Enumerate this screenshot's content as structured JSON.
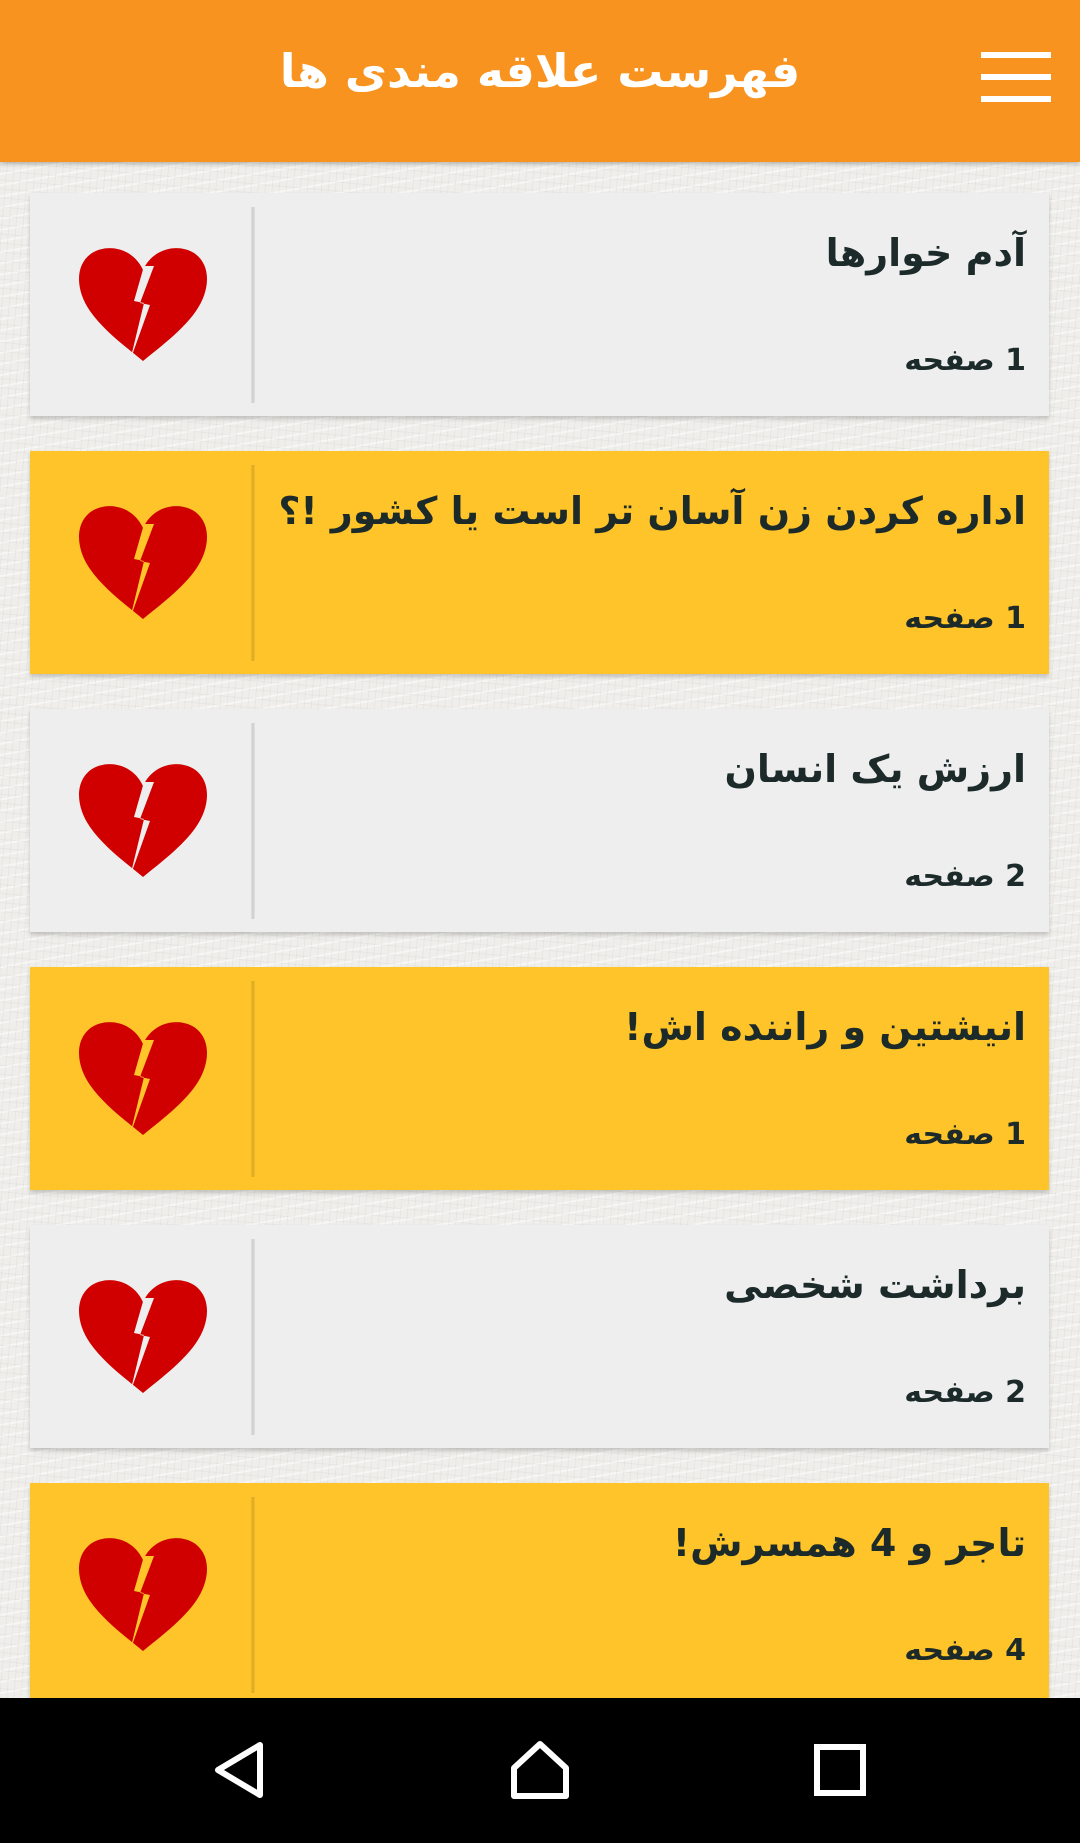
{
  "header": {
    "title": "فهرست علاقه مندی ها",
    "menu_icon": "hamburger-menu-icon",
    "background_color": "#f7931e"
  },
  "favorites": {
    "item_icon": "broken-heart-icon",
    "heart_color": "#d00000",
    "colors": {
      "gray_card": "#eeeeee",
      "yellow_card": "#fec429"
    },
    "items": [
      {
        "title": "آدم خوارها",
        "pages": "1 صفحه",
        "style": "gray"
      },
      {
        "title": "اداره کردن زن آسان تر است یا کشور !؟",
        "pages": "1 صفحه",
        "style": "yellow"
      },
      {
        "title": "ارزش یک انسان",
        "pages": "2 صفحه",
        "style": "gray"
      },
      {
        "title": "انیشتین و راننده اش!",
        "pages": "1 صفحه",
        "style": "yellow"
      },
      {
        "title": "برداشت شخصی",
        "pages": "2 صفحه",
        "style": "gray"
      },
      {
        "title": "تاجر و 4 همسرش!",
        "pages": "4 صفحه",
        "style": "yellow"
      }
    ]
  },
  "nav": {
    "back_icon": "back-triangle-icon",
    "home_icon": "home-icon",
    "recents_icon": "recents-square-icon"
  }
}
